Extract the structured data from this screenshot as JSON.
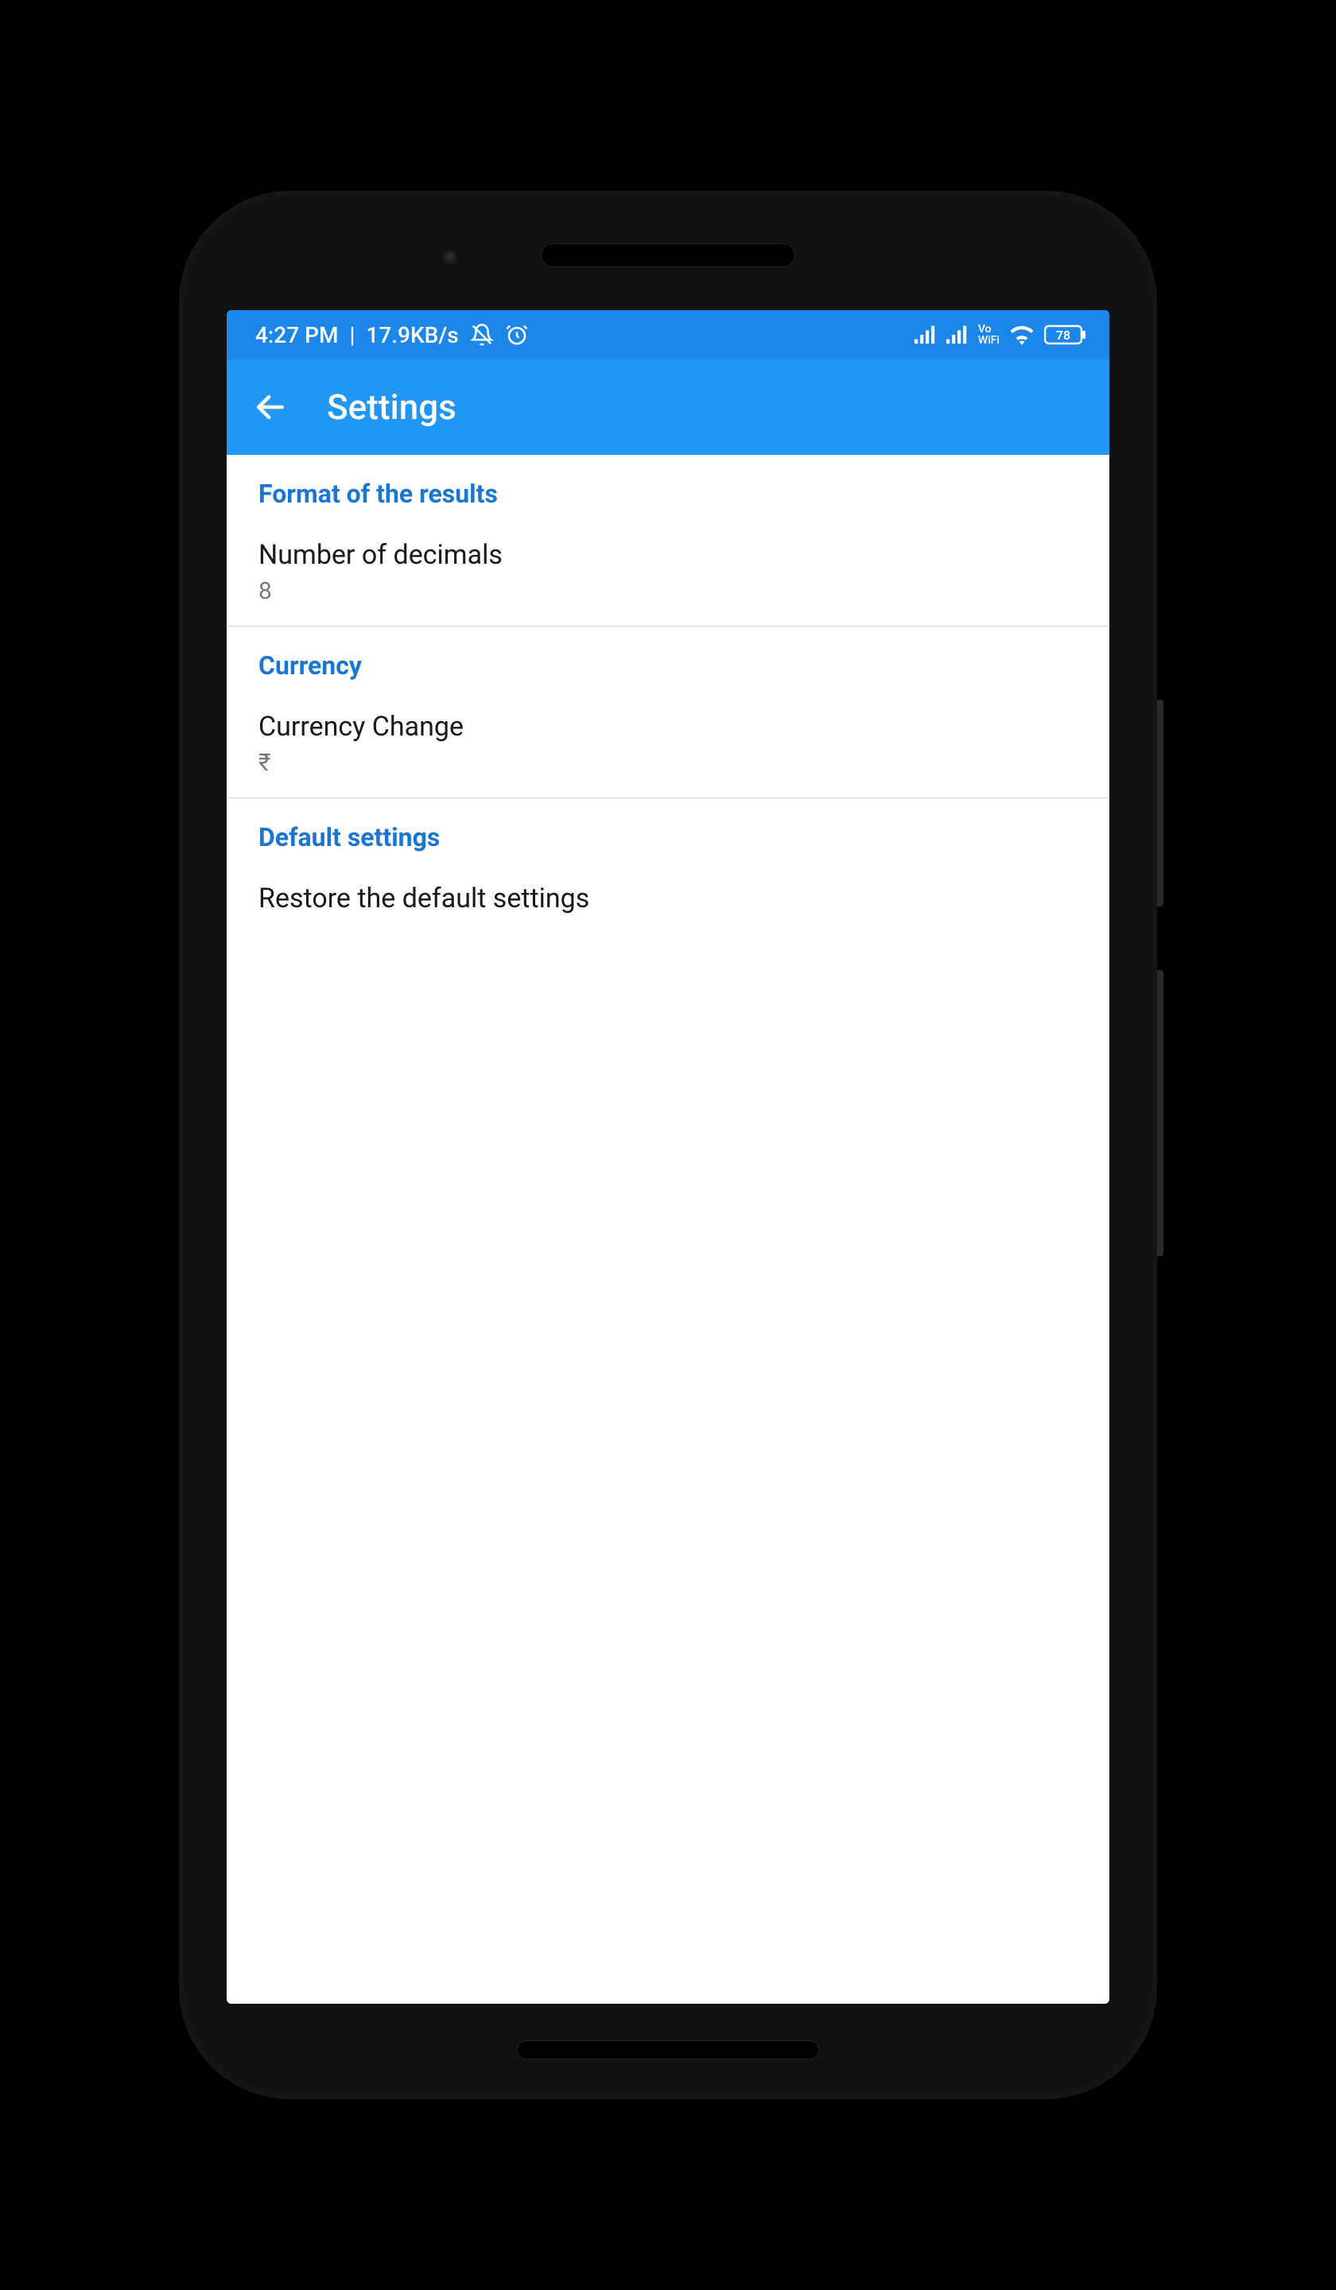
{
  "status": {
    "time": "4:27 PM",
    "net_speed": "17.9KB/s",
    "battery_level": "78",
    "vowifi_label": "Vo\nWiFi"
  },
  "appbar": {
    "title": "Settings"
  },
  "sections": {
    "format": {
      "header": "Format of the results",
      "item_title": "Number of decimals",
      "item_value": "8"
    },
    "currency": {
      "header": "Currency",
      "item_title": "Currency Change",
      "item_value": "₹"
    },
    "defaults": {
      "header": "Default settings",
      "item_title": "Restore the default settings"
    }
  }
}
